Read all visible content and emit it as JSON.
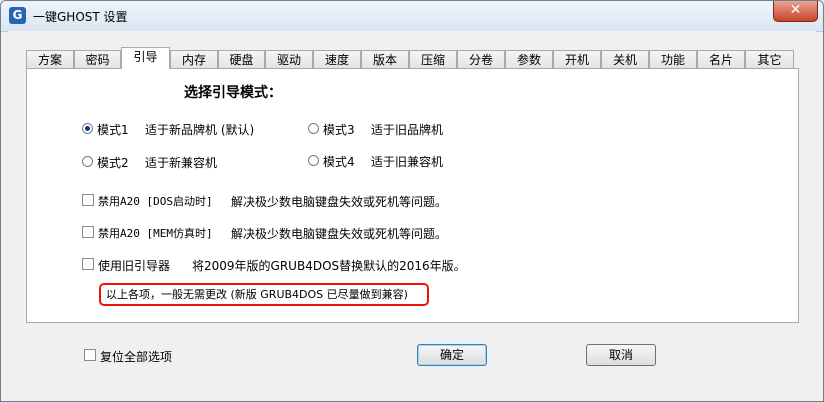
{
  "window": {
    "title": "一键GHOST 设置",
    "icon": "G",
    "close_label": "✕"
  },
  "tabs": [
    "方案",
    "密码",
    "引导",
    "内存",
    "硬盘",
    "驱动",
    "速度",
    "版本",
    "压缩",
    "分卷",
    "参数",
    "开机",
    "关机",
    "功能",
    "名片",
    "其它"
  ],
  "active_tab_index": 2,
  "section_title": "选择引导模式：",
  "modes": [
    {
      "label": "模式1",
      "desc": "适于新品牌机 (默认)",
      "checked": true
    },
    {
      "label": "模式3",
      "desc": "适于旧品牌机",
      "checked": false
    },
    {
      "label": "模式2",
      "desc": "适于新兼容机",
      "checked": false
    },
    {
      "label": "模式4",
      "desc": "适于旧兼容机",
      "checked": false
    }
  ],
  "options": [
    {
      "label": "禁用A20 [DOS启动时]",
      "desc": "解决极少数电脑键盘失效或死机等问题。"
    },
    {
      "label": "禁用A20 [MEM仿真时]",
      "desc": "解决极少数电脑键盘失效或死机等问题。"
    },
    {
      "label": "使用旧引导器",
      "desc": "将2009年版的GRUB4DOS替换默认的2016年版。"
    }
  ],
  "note": "以上各项，一般无需更改 (新版 GRUB4DOS 已尽量做到兼容)",
  "footer": {
    "reset_label": "复位全部选项",
    "ok_label": "确定",
    "cancel_label": "取消"
  }
}
